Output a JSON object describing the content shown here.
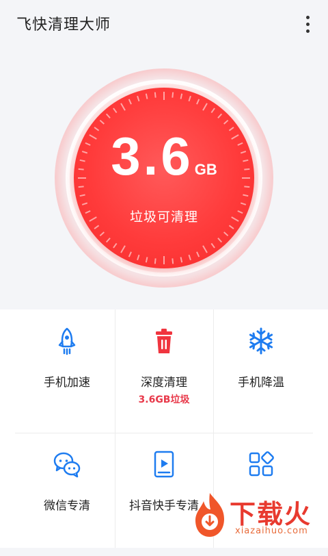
{
  "app": {
    "title": "飞快清理大师"
  },
  "hero": {
    "value": "3.6",
    "unit": "GB",
    "label": "垃圾可清理"
  },
  "features": [
    {
      "label": "手机加速",
      "icon": "rocket-icon"
    },
    {
      "label": "深度清理",
      "sublabel": "3.6GB垃圾",
      "icon": "trash-icon"
    },
    {
      "label": "手机降温",
      "icon": "snowflake-icon"
    },
    {
      "label": "微信专清",
      "icon": "wechat-icon"
    },
    {
      "label": "抖音快手专清",
      "icon": "video-play-icon"
    },
    {
      "label": "",
      "icon": "apps-grid-icon"
    }
  ],
  "colors": {
    "accent_blue": "#1e7cf0",
    "danger_red": "#ff3b3b",
    "sub_red": "#e8394a"
  },
  "watermark": {
    "text": "下载火",
    "url": "xiazaihuo.com"
  }
}
